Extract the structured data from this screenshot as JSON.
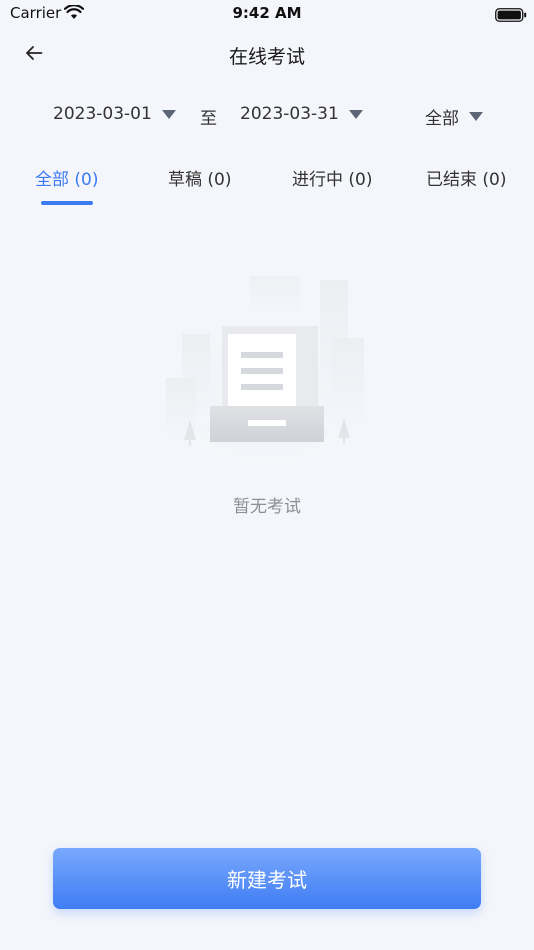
{
  "status_bar": {
    "carrier": "Carrier",
    "time": "9:42 AM",
    "wifi_icon": "wifi-icon",
    "battery_icon": "battery-icon"
  },
  "nav": {
    "back_icon": "arrow-left-icon",
    "title": "在线考试"
  },
  "filters": {
    "start_date": "2023-03-01",
    "to_label": "至",
    "end_date": "2023-03-31",
    "status": "全部",
    "caret_icon": "caret-down-icon"
  },
  "tabs": [
    {
      "label": "全部 (0)",
      "active": true
    },
    {
      "label": "草稿 (0)",
      "active": false
    },
    {
      "label": "进行中 (0)",
      "active": false
    },
    {
      "label": "已结束 (0)",
      "active": false
    }
  ],
  "empty_state": {
    "illustration_icon": "empty-document-illustration",
    "text": "暂无考试"
  },
  "footer": {
    "create_label": "新建考试"
  },
  "colors": {
    "background": "#f4f6fb",
    "accent": "#3b7bf2",
    "button_gradient_top": "#79a8fd",
    "button_gradient_bottom": "#3f7df4",
    "muted_text": "#8c8f96"
  }
}
